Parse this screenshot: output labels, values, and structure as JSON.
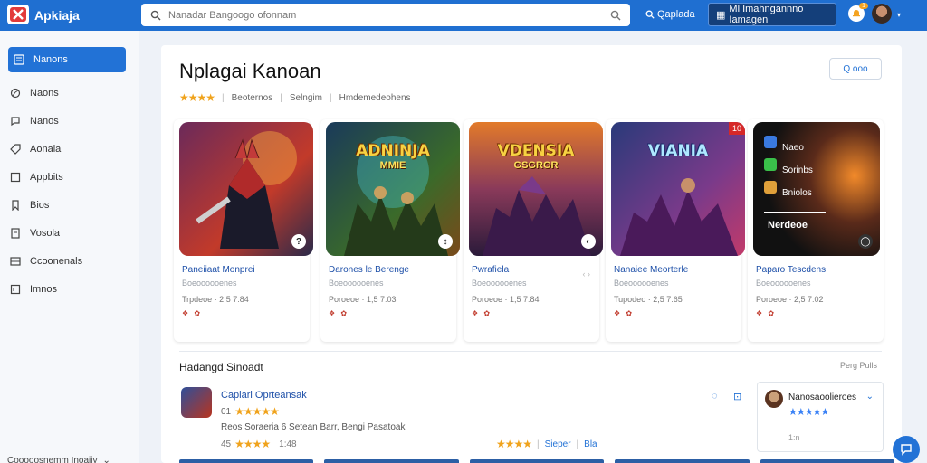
{
  "app": {
    "name": "Apkiaja"
  },
  "search": {
    "placeholder": "Nanadar Bangoogo ofonnam"
  },
  "topbar": {
    "search_link": "Qaplada",
    "action_button": "Ml Imahngannno Iamagen",
    "notif_count": "1"
  },
  "sidebar": {
    "items": [
      {
        "label": "Nanons",
        "icon": "list-icon",
        "active": true
      },
      {
        "label": "Naons",
        "icon": "circle-icon"
      },
      {
        "label": "Nanos",
        "icon": "chat-icon"
      },
      {
        "label": "Aonala",
        "icon": "tag-icon"
      },
      {
        "label": "Appbits",
        "icon": "square-icon"
      },
      {
        "label": "Bios",
        "icon": "bookmark-icon"
      },
      {
        "label": "Vosola",
        "icon": "doc-icon"
      },
      {
        "label": "Ccoonenals",
        "icon": "grid-icon"
      },
      {
        "label": "Imnos",
        "icon": "box-icon"
      }
    ],
    "footer": "Cooooosnemm Inoaiiy"
  },
  "page": {
    "title": "Nplagai Kanoan",
    "rating_stars": "★★★★",
    "meta": [
      "Beoternos",
      "Selngim",
      "Hmdemedeohens"
    ],
    "follow": "Q ooo"
  },
  "cards": [
    {
      "art_title": "",
      "art_sub": "",
      "corner": "?",
      "title": "Paneiiaat Monprei",
      "sub": "Boeoooooenes",
      "price": "Trpdeoe · 2,5 7:84",
      "icons": "❖ ✿",
      "share": "",
      "ribbon": "",
      "colors": [
        "#6a2a1a",
        "#c23a2a",
        "#2a2a4a"
      ]
    },
    {
      "art_title": "ADNINJA",
      "art_sub": "MMIE",
      "corner": "↕",
      "title": "Darones le Berenge",
      "sub": "Boeoooooenes",
      "price": "Poroeoe · 1,5 7:03",
      "icons": "❖ ✿",
      "share": "",
      "ribbon": "",
      "colors": [
        "#1a3a3a",
        "#3a6a2a",
        "#c28a2a"
      ]
    },
    {
      "art_title": "VDENSIA",
      "art_sub": "GSGRGR",
      "corner": "◐",
      "title": "Pwrafiela",
      "sub": "Boeoooooenes",
      "price": "Poroeoe · 1,5 7:84",
      "icons": "❖ ✿",
      "share": "‹ ›",
      "ribbon": "",
      "colors": [
        "#3a1a3a",
        "#8a3a2a",
        "#e27a2a"
      ]
    },
    {
      "art_title": "VIANIA",
      "art_sub": "",
      "corner": "",
      "title": "Nanaiee Meorterle",
      "sub": "Boeoooooenes",
      "price": "Tupodeo · 2,5 7:65",
      "icons": "❖ ✿",
      "share": "",
      "ribbon": "10",
      "colors": [
        "#2a2a5a",
        "#7a3a8a",
        "#c23a6a"
      ]
    },
    {
      "art_title": "",
      "art_sub": "",
      "corner": "◯",
      "title": "Paparo Tescdens",
      "sub": "Boeoooooenes",
      "price": "Poroeoe · 2,5 7:02",
      "icons": "❖ ✿",
      "share": "",
      "ribbon": "",
      "colors": [
        "#1a1a1a",
        "#3a2a1a",
        "#e26a1a"
      ],
      "menu": [
        "Naeo",
        "Sorinbs",
        "Bniolos",
        "Nerdeoe"
      ]
    }
  ],
  "recommended": {
    "title": "Hadangd Sinoadt",
    "more": "Perg Pulls",
    "app": {
      "name": "Caplari Oprteansak",
      "rating_prefix": "01",
      "stars": "★★★★★",
      "description": "Reos Soraeria 6 Setean Barr, Bengi Pasatoak",
      "rating2_prefix": "45",
      "stars2": "★★★★",
      "rating2_suffix": "1:48",
      "stars3": "★★★★",
      "meta_a": "Sieper",
      "meta_b": "Bla"
    },
    "side_card": {
      "name": "Nanosaoolieroes",
      "stars": "★★★★★",
      "foot": "1:n"
    }
  },
  "colors": {
    "primary": "#1f6fd1",
    "accent": "#f0a31c",
    "dark_button": "#143f7a"
  }
}
